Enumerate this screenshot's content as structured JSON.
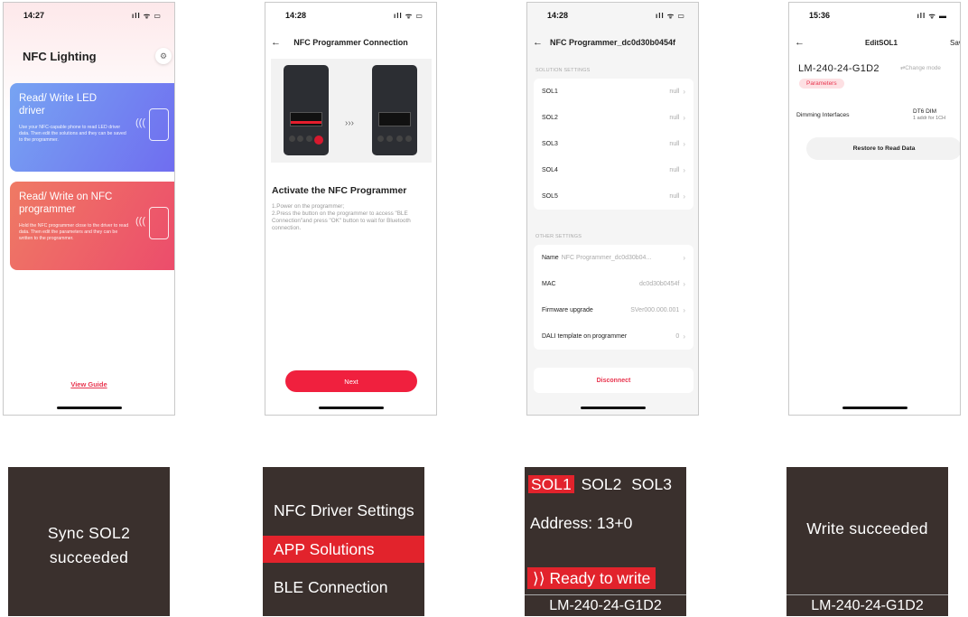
{
  "phone1": {
    "time": "14:27",
    "signal": "ıll ᯤ ▭",
    "title": "NFC Lighting",
    "card1": {
      "title": "Read/ Write LED driver",
      "desc": "Use your NFC-capable phone to read LED driver data. Then edit the solutions and they can be saved to the programmer."
    },
    "card2": {
      "title": "Read/ Write on NFC programmer",
      "desc": "Hold the NFC programmer close to the driver to read data. Then edit the parameters and they can be written to the programmer."
    },
    "view_guide": "View Guide"
  },
  "phone2": {
    "time": "14:28",
    "signal": "ıll ᯤ ▭",
    "title": "NFC Programmer Connection",
    "activate_title": "Activate the NFC Programmer",
    "activate_desc": "1.Power on the programmer;\n2.Press the button on the programmer to access \"BLE Connection\"and press \"OK\" button to wait for Bluetooth connection.",
    "next": "Next"
  },
  "phone3": {
    "time": "14:28",
    "signal": "ıll ᯤ ▭",
    "title": "NFC Programmer_dc0d30b0454f",
    "solution_header": "SOLUTION SETTINGS",
    "solutions": [
      {
        "label": "SOL1",
        "value": "null"
      },
      {
        "label": "SOL2",
        "value": "null"
      },
      {
        "label": "SOL3",
        "value": "null"
      },
      {
        "label": "SOL4",
        "value": "null"
      },
      {
        "label": "SOL5",
        "value": "null"
      }
    ],
    "other_header": "OTHER SETTINGS",
    "name_label": "Name",
    "name_value": "NFC Programmer_dc0d30b04...",
    "mac_label": "MAC",
    "mac_value": "dc0d30b0454f",
    "fw_label": "Firmware upgrade",
    "fw_value": "SVer000.000.001",
    "dali_label": "DALI template on programmer",
    "dali_value": "0",
    "disconnect": "Disconnect"
  },
  "phone4": {
    "time": "15:36",
    "signal": "ıll ᯤ ▬",
    "title": "EditSOL1",
    "save": "Save",
    "model": "LM-240-24-G1D2",
    "change_mode": "⇄Change mode",
    "tab": "Parameters",
    "dim_label": "Dimming Interfaces",
    "dim_value": "DT6 DIM",
    "dim_sub": "1 addr for 1CH",
    "restore": "Restore to Read Data"
  },
  "screen1": {
    "line1": "Sync  SOL2",
    "line2": "succeeded"
  },
  "screen2": {
    "item1": "NFC Driver Settings",
    "item2": "APP Solutions",
    "item3": "BLE Connection"
  },
  "screen3": {
    "tab1": "SOL1",
    "tab2": "SOL2",
    "tab3": "SOL3",
    "address": "Address: 13+0",
    "ready": "⟩⟩ Ready to write",
    "footer": "LM-240-24-G1D2"
  },
  "screen4": {
    "message": "Write succeeded",
    "footer": "LM-240-24-G1D2"
  },
  "colors": {
    "accent": "#e8344e",
    "lcd_bg": "#3a302d",
    "lcd_highlight": "#e2232c"
  }
}
